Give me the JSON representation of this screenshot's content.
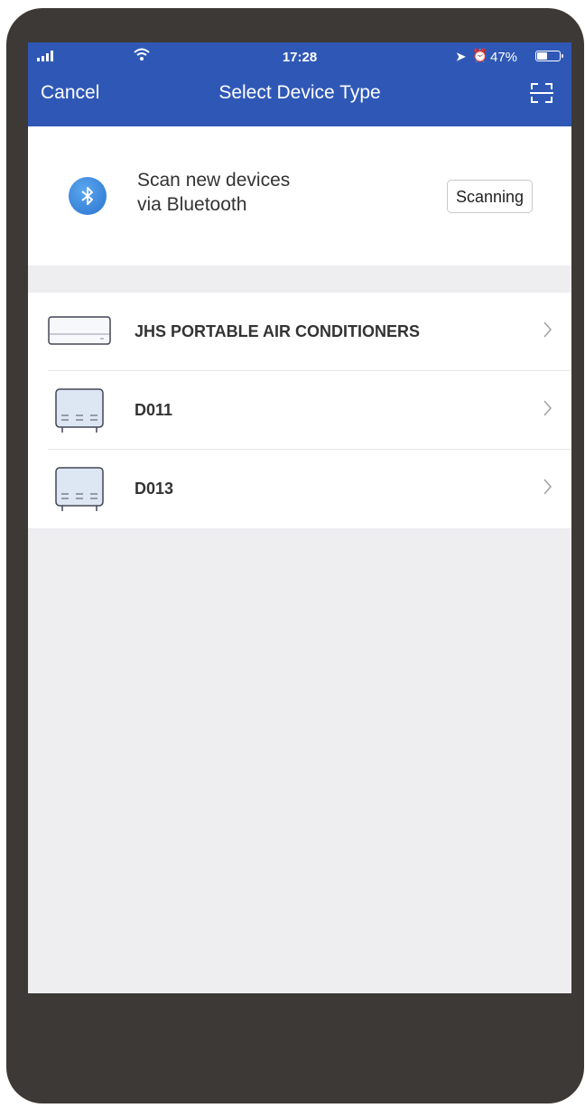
{
  "status_bar": {
    "signal": "••▌▐",
    "time": "17:28",
    "battery": "47%",
    "battery_level": 0.47
  },
  "navbar": {
    "cancel": "Cancel",
    "title": "Select Device Type",
    "scan_icon": "qr-scan-icon"
  },
  "bluetooth": {
    "icon": "bluetooth-icon",
    "line1": "Scan new devices",
    "line2": "via Bluetooth",
    "button": "Scanning"
  },
  "devices": [
    {
      "label": "JHS PORTABLE AIR CONDITIONERS",
      "icon": "wall-ac-icon"
    },
    {
      "label": "D011",
      "icon": "dehumidifier-icon"
    },
    {
      "label": "D013",
      "icon": "dehumidifier-icon"
    }
  ],
  "colors": {
    "header": "#2f58b6",
    "frame": "#3d3936",
    "background": "#eeeef1"
  }
}
